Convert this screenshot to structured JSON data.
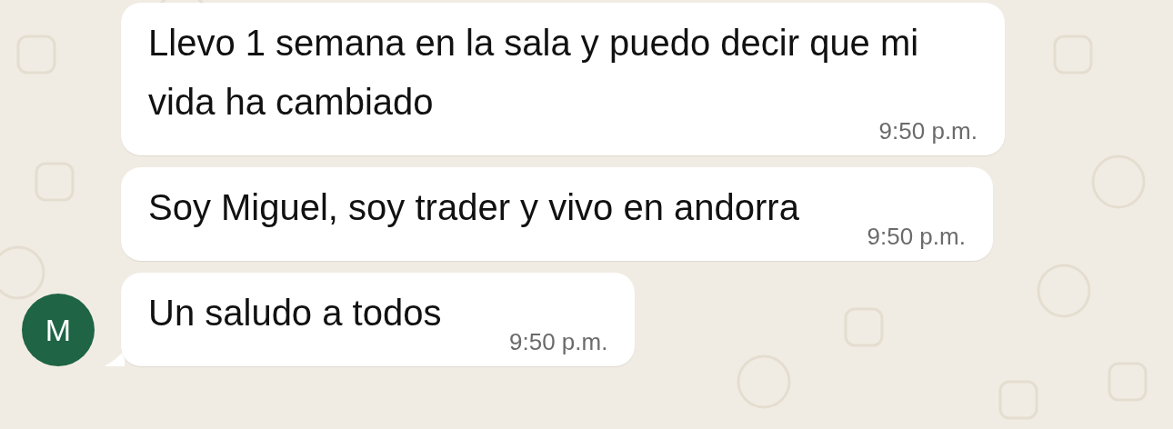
{
  "messages": [
    {
      "text": "Llevo 1 semana en la sala y puedo decir que mi vida ha cambiado",
      "time": "9:50 p.m."
    },
    {
      "text": "Soy Miguel, soy trader y vivo en andorra",
      "time": "9:50 p.m."
    },
    {
      "text": "Un saludo a todos",
      "time": "9:50 p.m.",
      "avatar": {
        "letter": "M",
        "color": "#1e6445"
      }
    }
  ]
}
